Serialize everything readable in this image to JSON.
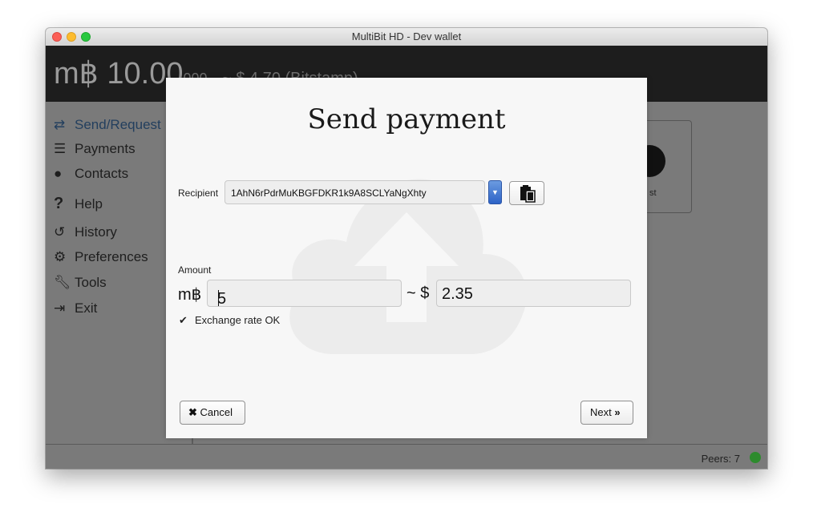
{
  "window": {
    "title": "MultiBit HD - Dev wallet"
  },
  "header": {
    "balance_symbol": "m฿",
    "balance_value": "10.00",
    "balance_satoshi": "000",
    "fiat_text": "~ $ 4.70 (Bitstamp)"
  },
  "sidebar": {
    "items": [
      {
        "label": "Send/Request",
        "icon": "arrows-icon",
        "active": true
      },
      {
        "label": "Payments",
        "icon": "list-icon"
      },
      {
        "label": "Contacts",
        "icon": "user-icon"
      },
      {
        "label": "Help",
        "icon": "question-icon"
      },
      {
        "label": "History",
        "icon": "history-icon"
      },
      {
        "label": "Preferences",
        "icon": "gears-icon"
      },
      {
        "label": "Tools",
        "icon": "wrench-icon"
      },
      {
        "label": "Exit",
        "icon": "exit-icon"
      }
    ]
  },
  "background_card": {
    "label": "st"
  },
  "statusbar": {
    "peers_label": "Peers: 7",
    "peer_status_color": "#2e8b2e"
  },
  "modal": {
    "title": "Send payment",
    "recipient_label": "Recipient",
    "recipient_value": "1AhN6rPdrMuKBGFDKR1k9A8SCLYaNgXhty",
    "amount_label": "Amount",
    "btc_symbol": "m฿",
    "btc_amount": "5",
    "approx_symbol": "~ $",
    "fiat_amount": "2.35",
    "exchange_status": "Exchange rate OK",
    "cancel_label": "Cancel",
    "next_label": "Next"
  },
  "colors": {
    "accent_active": "#233f5e",
    "header_bg": "#1d1d1d",
    "dropdown_blue": "#2d63c7"
  }
}
